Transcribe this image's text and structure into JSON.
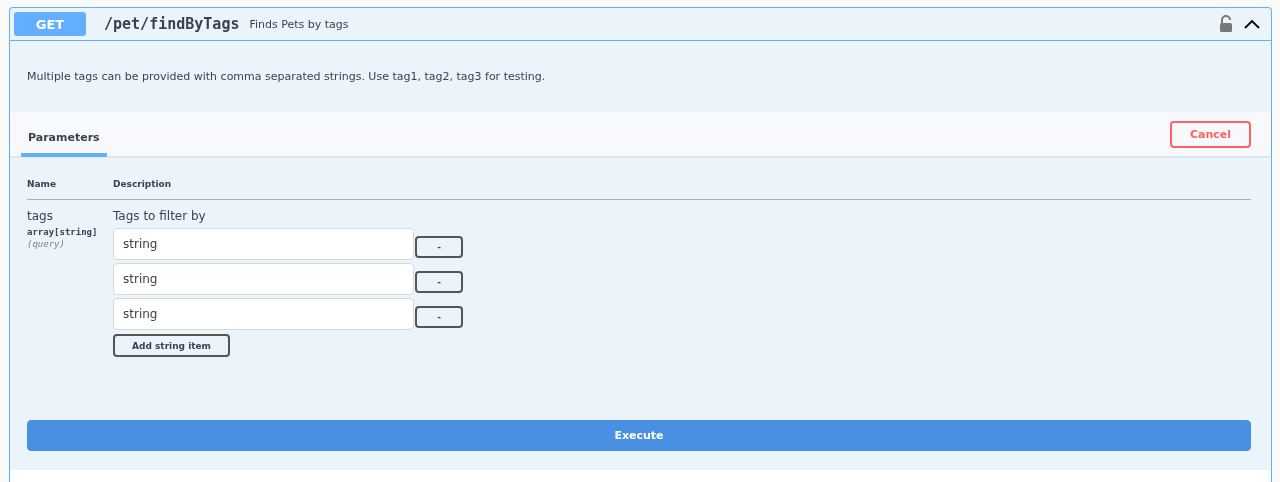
{
  "operation": {
    "method": "GET",
    "path": "/pet/findByTags",
    "summary": "Finds Pets by tags",
    "expanded": true
  },
  "description": "Multiple tags can be provided with comma separated strings. Use tag1, tag2, tag3 for testing.",
  "tabs": [
    {
      "label": "Parameters",
      "selected": true
    }
  ],
  "cancel_button": "Cancel",
  "table": {
    "columns": [
      "Name",
      "Description"
    ],
    "rows": [
      {
        "name": "tags",
        "type": "array[string]",
        "location": "(query)",
        "description": "Tags to filter by",
        "items": [
          {
            "value": "string",
            "remove": "-"
          },
          {
            "value": "string",
            "remove": "-"
          },
          {
            "value": "string",
            "remove": "-"
          }
        ],
        "add_button": "Add string item"
      }
    ]
  },
  "execute_button": "Execute"
}
